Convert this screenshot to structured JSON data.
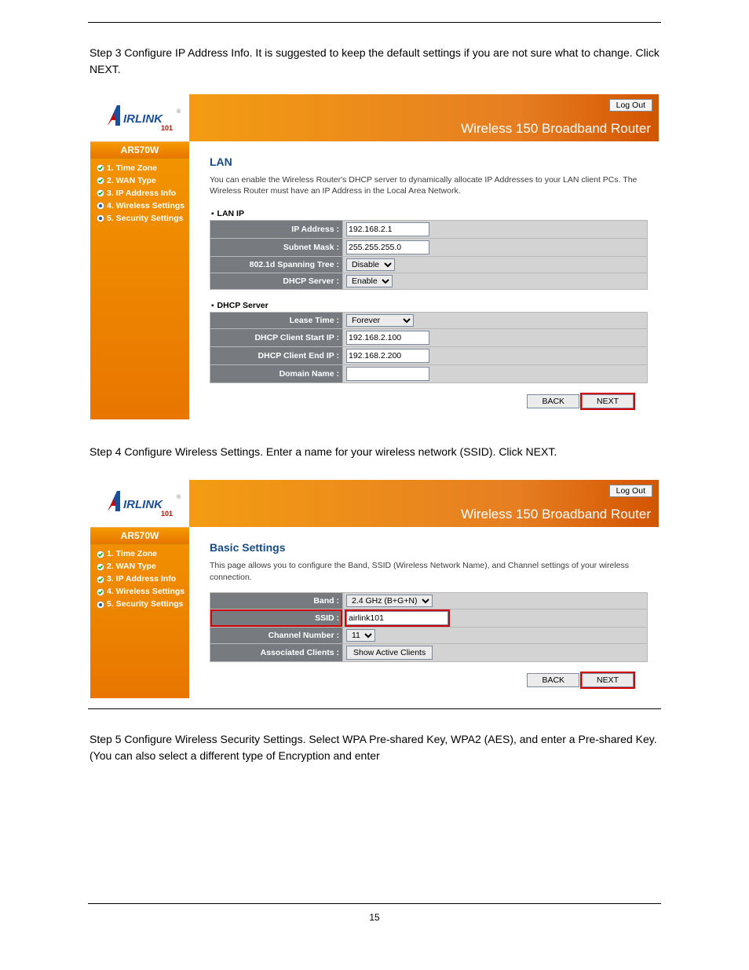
{
  "step3_intro": "Step 3 Configure IP Address Info. It is suggested to keep the default settings if you are not sure what to change. Click NEXT.",
  "step4_intro": "Step 4 Configure Wireless Settings. Enter a name for your wireless network (SSID). Click NEXT.",
  "step5_intro": "Step 5 Configure Wireless Security Settings. Select WPA Pre-shared Key, WPA2 (AES), and enter a Pre-shared Key. (You can also select a different type of Encryption and enter",
  "page_number": "15",
  "common": {
    "logout": "Log Out",
    "header_title": "Wireless 150 Broadband Router",
    "model": "AR570W",
    "back": "BACK",
    "next": "NEXT",
    "nav": [
      "1. Time Zone",
      "2. WAN Type",
      "3. IP Address Info",
      "4. Wireless Settings",
      "5. Security Settings"
    ]
  },
  "step3": {
    "title": "LAN",
    "desc": "You can enable the Wireless Router's DHCP server to dynamically allocate IP Addresses to your LAN client PCs. The Wireless Router must have an IP Address in the Local Area Network.",
    "lanip_header": "LAN IP",
    "dhcp_header": "DHCP Server",
    "rows": {
      "ip_addr_label": "IP Address :",
      "ip_addr_value": "192.168.2.1",
      "subnet_label": "Subnet Mask :",
      "subnet_value": "255.255.255.0",
      "spanning_label": "802.1d Spanning Tree :",
      "spanning_value": "Disable",
      "dhcp_server_label": "DHCP Server :",
      "dhcp_server_value": "Enable",
      "lease_label": "Lease Time :",
      "lease_value": "Forever",
      "start_ip_label": "DHCP Client Start IP :",
      "start_ip_value": "192.168.2.100",
      "end_ip_label": "DHCP Client End IP :",
      "end_ip_value": "192.168.2.200",
      "domain_label": "Domain Name :",
      "domain_value": ""
    }
  },
  "step4": {
    "title": "Basic Settings",
    "desc": "This page allows you to configure the Band, SSID (Wireless Network Name), and Channel settings of your wireless connection.",
    "rows": {
      "band_label": "Band :",
      "band_value": "2.4 GHz (B+G+N)",
      "ssid_label": "SSID :",
      "ssid_value": "airlink101",
      "channel_label": "Channel Number :",
      "channel_value": "11",
      "assoc_label": "Associated Clients :",
      "assoc_btn": "Show Active Clients"
    }
  }
}
